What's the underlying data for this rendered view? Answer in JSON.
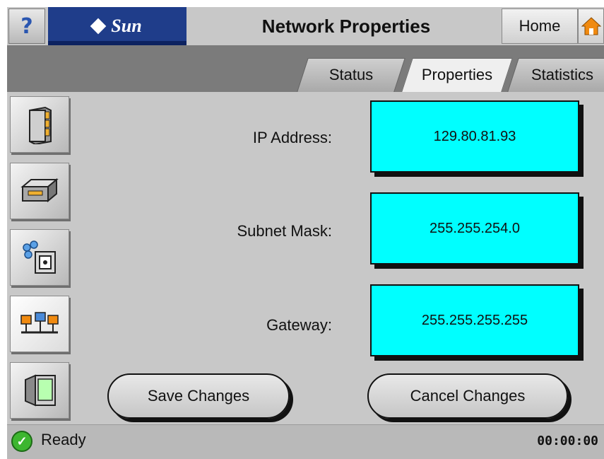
{
  "header": {
    "help_label": "?",
    "logo_text": "Sun",
    "title": "Network Properties",
    "home_label": "Home",
    "home_icon": "house-icon"
  },
  "tabs": [
    {
      "label": "Status",
      "active": false
    },
    {
      "label": "Properties",
      "active": true
    },
    {
      "label": "Statistics",
      "active": false
    }
  ],
  "sidebar": {
    "items": [
      {
        "icon": "server-tower-icon",
        "active": false
      },
      {
        "icon": "disk-drive-icon",
        "active": false
      },
      {
        "icon": "storage-device-icon",
        "active": false
      },
      {
        "icon": "network-icon",
        "active": true
      },
      {
        "icon": "monitor-icon",
        "active": false
      }
    ]
  },
  "form": {
    "ip_label": "IP Address:",
    "ip_value": "129.80.81.93",
    "subnet_label": "Subnet Mask:",
    "subnet_value": "255.255.254.0",
    "gateway_label": "Gateway:",
    "gateway_value": "255.255.255.255"
  },
  "actions": {
    "save_label": "Save Changes",
    "cancel_label": "Cancel Changes"
  },
  "status": {
    "icon": "check-icon",
    "text": "Ready",
    "time": "00:00:00"
  },
  "colors": {
    "field_bg": "#00ffff",
    "logo_bg": "#1f3d8a",
    "status_ok": "#3db62f",
    "home_accent": "#f08a10"
  }
}
